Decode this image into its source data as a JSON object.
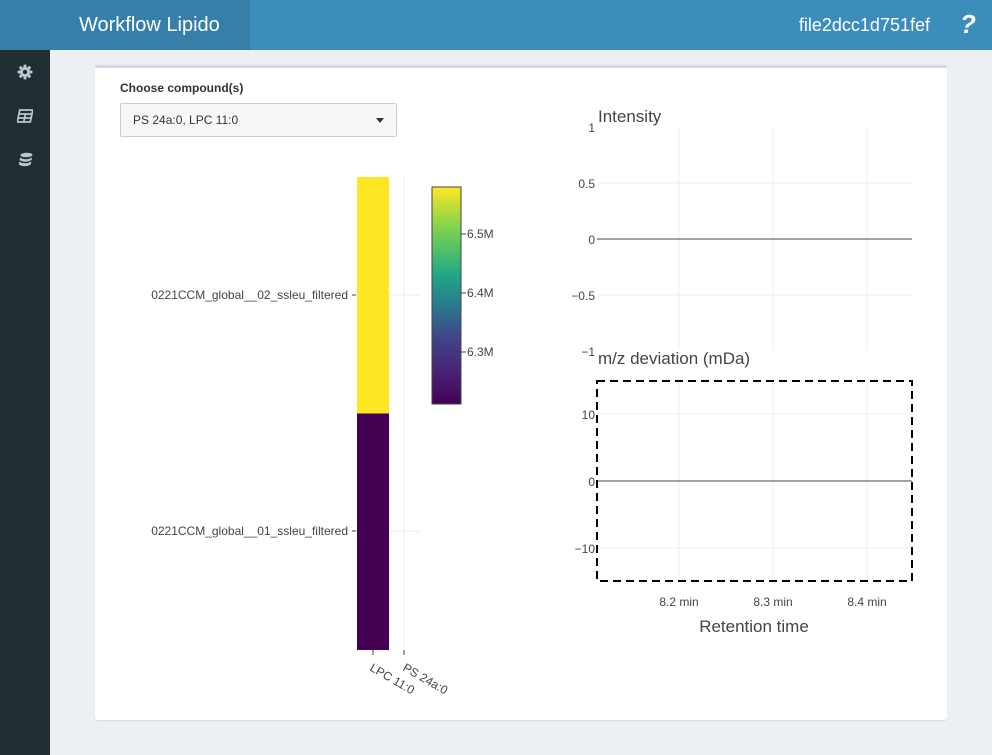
{
  "app": {
    "title": "Workflow Lipido",
    "file_name": "file2dcc1d751fef",
    "help_glyph": "?"
  },
  "sidebar": {
    "items": [
      {
        "icon": "gear-icon"
      },
      {
        "icon": "table-icon"
      },
      {
        "icon": "database-icon"
      }
    ]
  },
  "form": {
    "label": "Choose compound(s)",
    "selected": "PS 24a:0, LPC 11:0"
  },
  "heatmap": {
    "rows": [
      "0221CCM_global__02_ssleu_filtered",
      "0221CCM_global__01_ssleu_filtered"
    ],
    "columns": [
      "LPC 11:0",
      "PS 24a:0"
    ],
    "colorbar_ticks": [
      "6.5M",
      "6.4M",
      "6.3M"
    ],
    "colors": {
      "high": "#fde725",
      "low": "#440154"
    }
  },
  "intensity_plot": {
    "title": "Intensity",
    "y_ticks": [
      "1",
      "0.5",
      "0",
      "−0.5",
      "−1"
    ]
  },
  "mz_plot": {
    "title": "m/z deviation (mDa)",
    "y_ticks": [
      "10",
      "0",
      "−10"
    ]
  },
  "x_axis": {
    "ticks": [
      "8.2 min",
      "8.3 min",
      "8.4 min"
    ],
    "title": "Retention time"
  },
  "chart_data": [
    {
      "type": "heatmap",
      "x": [
        "LPC 11:0",
        "PS 24a:0"
      ],
      "y": [
        "0221CCM_global__02_ssleu_filtered",
        "0221CCM_global__01_ssleu_filtered"
      ],
      "values": [
        [
          6.58,
          null
        ],
        [
          6.22,
          null
        ]
      ],
      "colorbar_ticks": [
        "6.5M",
        "6.4M",
        "6.3M"
      ]
    },
    {
      "type": "line",
      "title": "Intensity",
      "ylim": [
        -1,
        1
      ],
      "x_ticks": [
        "8.2 min",
        "8.3 min",
        "8.4 min"
      ],
      "series": [
        {
          "values": [
            0,
            0
          ]
        }
      ],
      "grid": true
    },
    {
      "type": "line",
      "title": "m/z deviation (mDa)",
      "ylim": [
        -15,
        15
      ],
      "xlabel": "Retention time",
      "x_ticks": [
        "8.2 min",
        "8.3 min",
        "8.4 min"
      ],
      "series": [
        {
          "values": [
            0,
            0
          ]
        }
      ],
      "grid": true
    }
  ]
}
